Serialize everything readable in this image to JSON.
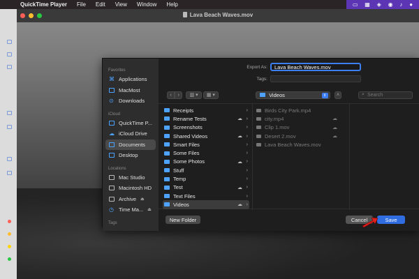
{
  "menubar": {
    "app_name": "QuickTime Player",
    "items": [
      "File",
      "Edit",
      "View",
      "Window",
      "Help"
    ]
  },
  "window": {
    "title": "Lava Beach Waves.mov"
  },
  "dialog": {
    "export_label": "Export As:",
    "export_value": "Lava Beach Waves.mov",
    "tags_label": "Tags:",
    "location": "Videos",
    "search_placeholder": "Search",
    "sidebar": {
      "favorites_label": "Favorites",
      "favorites": [
        "Applications",
        "MacMost",
        "Downloads"
      ],
      "icloud_label": "iCloud",
      "icloud": [
        "QuickTime P...",
        "iCloud Drive",
        "Documents",
        "Desktop"
      ],
      "locations_label": "Locations",
      "locations": [
        "Mac Studio",
        "Macintosh HD",
        "Archive",
        "Time Ma..."
      ],
      "tags_label": "Tags"
    },
    "folders": [
      "Receipts",
      "Rename Tests",
      "Screenshots",
      "Shared Videos",
      "Smart Files",
      "Some Files",
      "Some Photos",
      "Stuff",
      "Temp",
      "Test",
      "Text Files",
      "Videos"
    ],
    "files": [
      "Birds City Park.mp4",
      "city.mp4",
      "Clip 1.mov",
      "Desert 2.mov",
      "Lava Beach Waves.mov"
    ],
    "new_folder": "New Folder",
    "cancel": "Cancel",
    "save": "Save"
  },
  "colors": {
    "accent": "#2f6de1",
    "folder": "#4da3ff",
    "status_bar": "#5b35b4"
  }
}
